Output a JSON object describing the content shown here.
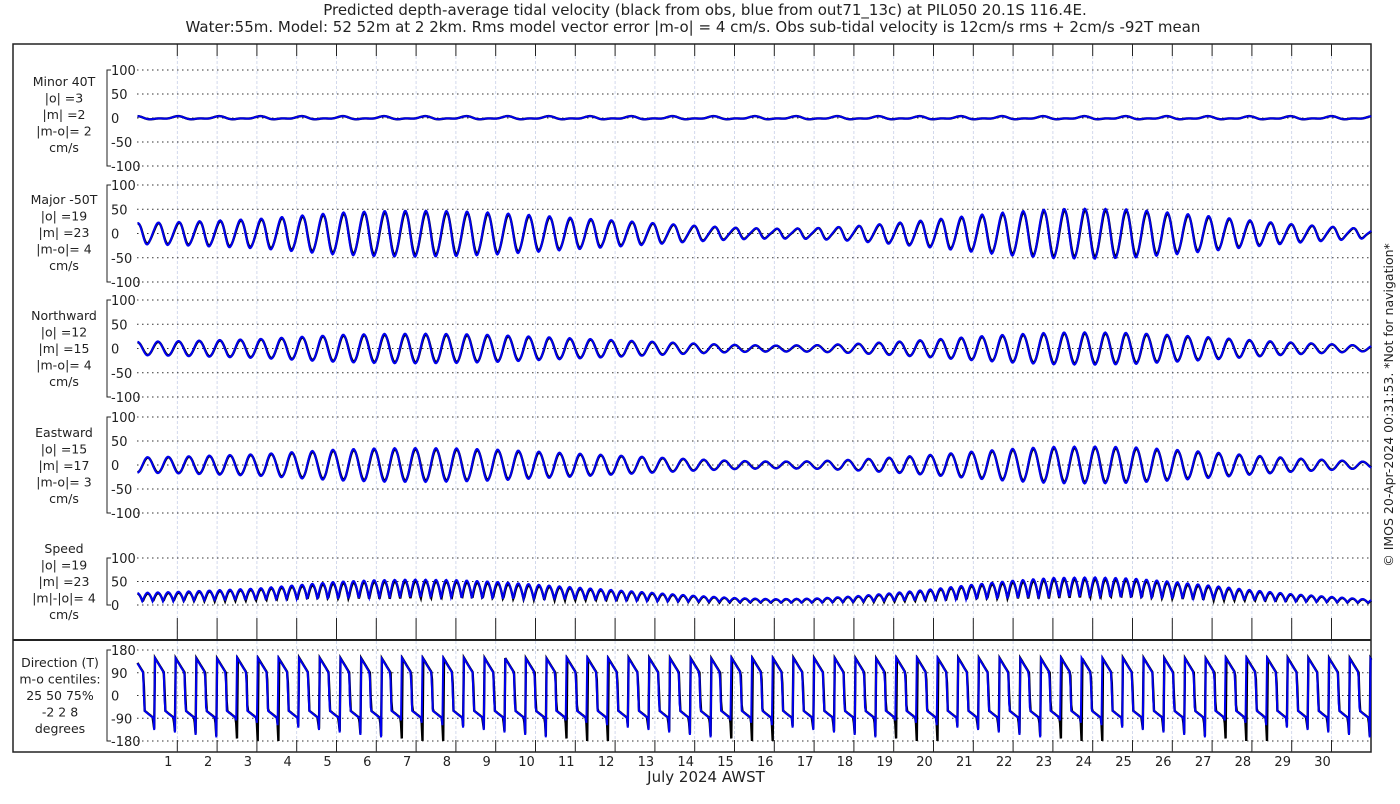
{
  "chart_data": {
    "type": "line",
    "title_lines": [
      "Predicted depth-average tidal velocity (black from obs, blue from out71_13c) at PIL050 20.1S 116.4E.",
      "Water:55m. Model: 52 52m at 2 2km. Rms model vector error |m-o| = 4 cm/s. Obs sub-tidal velocity is 12cm/s rms + 2cm/s -92T mean"
    ],
    "xlabel": "July 2024 AWST",
    "x_tick_labels": [
      "1",
      "2",
      "3",
      "4",
      "5",
      "6",
      "7",
      "8",
      "9",
      "10",
      "11",
      "12",
      "13",
      "14",
      "15",
      "16",
      "17",
      "18",
      "19",
      "20",
      "21",
      "22",
      "23",
      "24",
      "25",
      "26",
      "27",
      "28",
      "29",
      "30"
    ],
    "x_range_days": [
      0,
      31
    ],
    "tidal_period_hours": 12.42,
    "legend": {
      "obs_color": "#000000",
      "model_color": "#0000ee"
    },
    "daily_envelope_major": [
      20,
      22,
      25,
      28,
      34,
      40,
      43,
      44,
      43,
      40,
      35,
      30,
      25,
      20,
      15,
      11,
      9,
      10,
      14,
      20,
      27,
      35,
      42,
      47,
      48,
      46,
      40,
      33,
      25,
      18,
      13
    ],
    "panels": [
      {
        "id": "minor",
        "labels": [
          "Minor 40T",
          "|o| =3",
          "|m| =2",
          "|m-o|= 2",
          "cm/s"
        ],
        "yticks": [
          "100",
          "50",
          "0",
          "-50",
          "-100"
        ],
        "ylim": [
          -100,
          100
        ],
        "scale": 0.1,
        "phase": 0.3
      },
      {
        "id": "major",
        "labels": [
          "Major -50T",
          "|o| =19",
          "|m| =23",
          "|m-o|= 4",
          "cm/s"
        ],
        "yticks": [
          "100",
          "50",
          "0",
          "-50",
          "-100"
        ],
        "ylim": [
          -100,
          100
        ],
        "scale": 1.0,
        "phase": 0.0
      },
      {
        "id": "north",
        "labels": [
          "Northward",
          "|o| =12",
          "|m| =15",
          "|m-o|= 4",
          "cm/s"
        ],
        "yticks": [
          "100",
          "50",
          "0",
          "-50",
          "-100"
        ],
        "ylim": [
          -100,
          100
        ],
        "scale": 0.65,
        "phase": 0.0
      },
      {
        "id": "east",
        "labels": [
          "Eastward",
          "|o| =15",
          "|m| =17",
          "|m-o|= 3",
          "cm/s"
        ],
        "yticks": [
          "100",
          "50",
          "0",
          "-50",
          "-100"
        ],
        "ylim": [
          -100,
          100
        ],
        "scale": 0.75,
        "phase": 3.14
      },
      {
        "id": "speed",
        "labels": [
          "Speed",
          "|o| =19",
          "|m| =23",
          "|m|-|o|= 4",
          "cm/s"
        ],
        "yticks": [
          "100",
          "50",
          "0"
        ],
        "ylim": [
          0,
          100
        ],
        "scale": 1.0,
        "phase": 0.0
      },
      {
        "id": "direction",
        "labels": [
          "Direction (T)",
          "m-o centiles:",
          "25  50  75%",
          "-2  2  8",
          "degrees"
        ],
        "yticks": [
          "180",
          "90",
          "0",
          "-90",
          "-180"
        ],
        "ylim": [
          -180,
          180
        ],
        "scale": 1.0,
        "phase": 0.0
      }
    ],
    "copyright": "© IMOS 20-Apr-2024 00:31:53. *Not for navigation*"
  }
}
